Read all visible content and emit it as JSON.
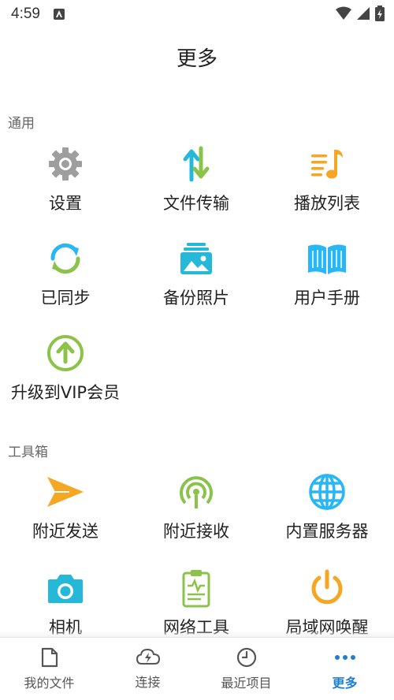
{
  "status_bar": {
    "time": "4:59"
  },
  "header": {
    "title": "更多"
  },
  "sections": {
    "general": {
      "label": "通用",
      "items": [
        {
          "label": "设置",
          "icon": "gear-icon"
        },
        {
          "label": "文件传输",
          "icon": "transfer-arrows-icon"
        },
        {
          "label": "播放列表",
          "icon": "playlist-icon"
        },
        {
          "label": "已同步",
          "icon": "sync-icon"
        },
        {
          "label": "备份照片",
          "icon": "backup-photo-icon"
        },
        {
          "label": "用户手册",
          "icon": "book-icon"
        },
        {
          "label": "升级到VIP会员",
          "icon": "upgrade-arrow-icon"
        }
      ]
    },
    "toolbox": {
      "label": "工具箱",
      "items": [
        {
          "label": "附近发送",
          "icon": "send-icon"
        },
        {
          "label": "附近接收",
          "icon": "receive-signal-icon"
        },
        {
          "label": "内置服务器",
          "icon": "globe-icon"
        },
        {
          "label": "相机",
          "icon": "camera-icon"
        },
        {
          "label": "网络工具",
          "icon": "clipboard-pulse-icon"
        },
        {
          "label": "局域网唤醒",
          "icon": "power-icon"
        }
      ]
    }
  },
  "bottom_nav": {
    "items": [
      {
        "label": "我的文件",
        "icon": "file-icon"
      },
      {
        "label": "连接",
        "icon": "cloud-bolt-icon"
      },
      {
        "label": "最近项目",
        "icon": "clock-icon"
      },
      {
        "label": "更多",
        "icon": "more-dots-icon"
      }
    ],
    "active_index": 3
  },
  "colors": {
    "gray": "#9e9e9e",
    "green": "#8bc34a",
    "teal": "#26b8d8",
    "orange": "#f5a623",
    "sky": "#29b6f6",
    "nav_active": "#1f7fd6"
  }
}
